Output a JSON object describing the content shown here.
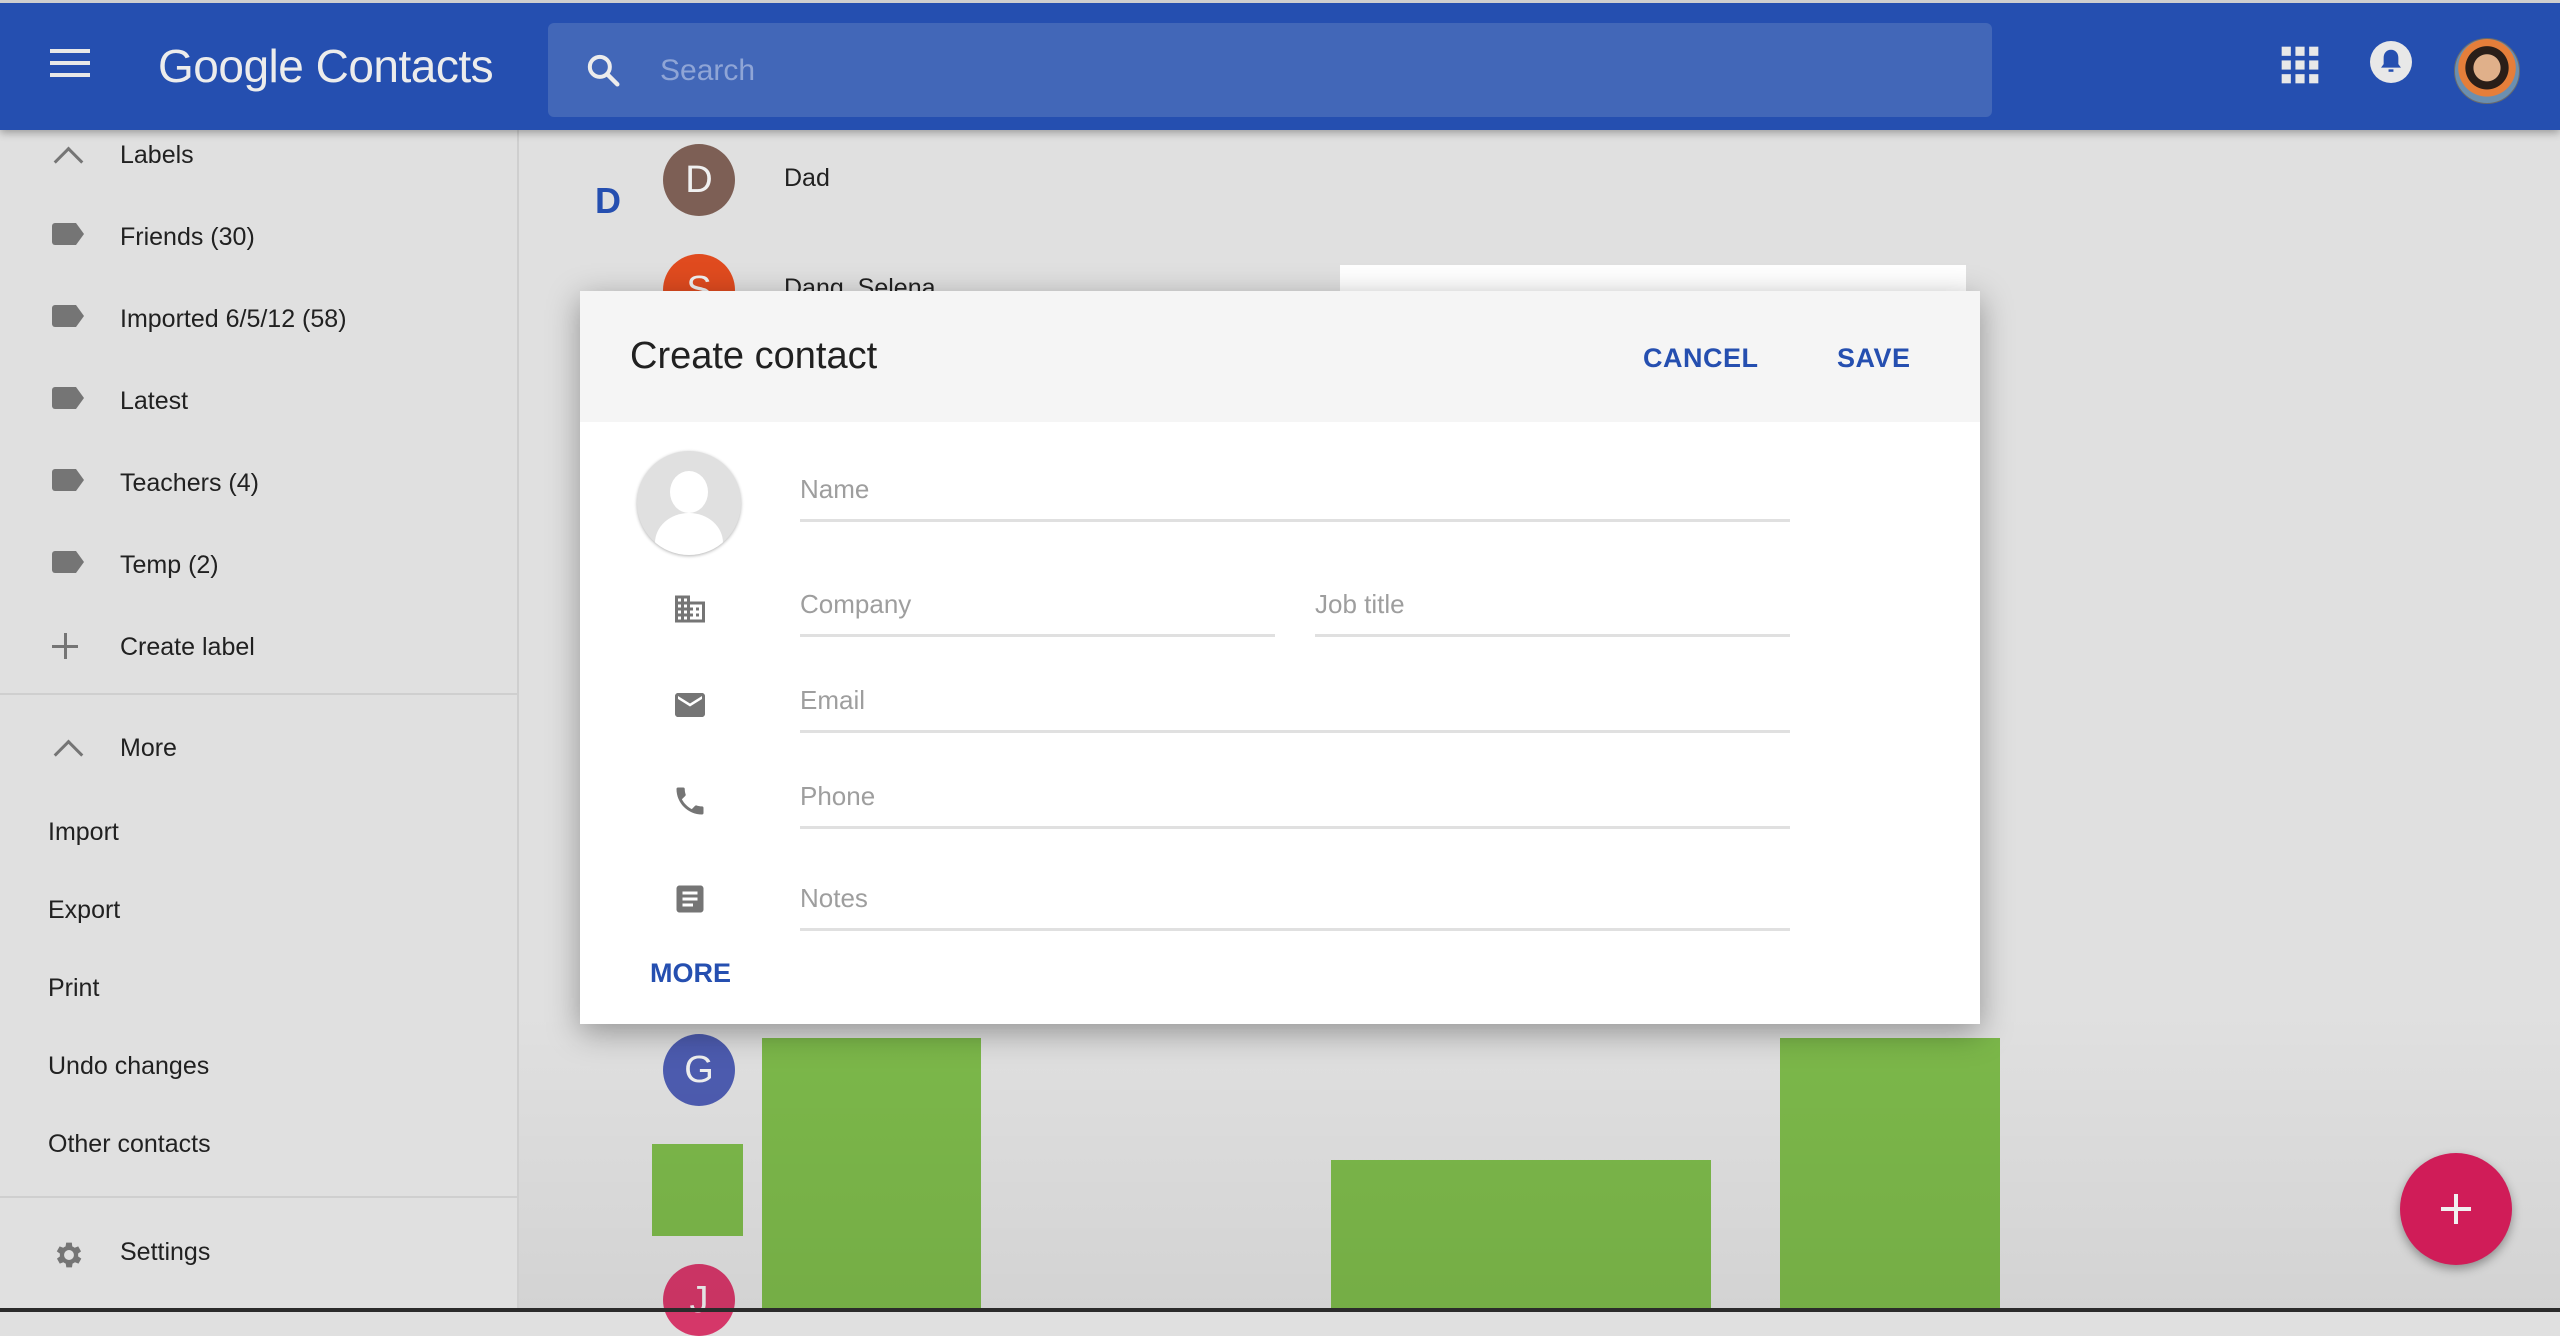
{
  "app": {
    "brand": "Google",
    "product": "Contacts"
  },
  "search": {
    "placeholder": "Search",
    "value": ""
  },
  "header_icons": {
    "apps": "apps-grid-icon",
    "notifications": "notifications-bell-icon",
    "account": "account-avatar"
  },
  "sidebar": {
    "labels_header": "Labels",
    "labels": [
      {
        "label": "Friends (30)",
        "icon": "label-icon"
      },
      {
        "label": "Imported 6/5/12 (58)",
        "icon": "label-icon"
      },
      {
        "label": "Latest",
        "icon": "label-icon"
      },
      {
        "label": "Teachers (4)",
        "icon": "label-icon"
      },
      {
        "label": "Temp (2)",
        "icon": "label-icon"
      }
    ],
    "create_label": "Create label",
    "more_header": "More",
    "more_items": [
      "Import",
      "Export",
      "Print",
      "Undo changes",
      "Other contacts"
    ],
    "settings": "Settings"
  },
  "contacts": {
    "section_letter": "D",
    "items": [
      {
        "initial": "D",
        "name": "Dad",
        "color": "#7d5f55"
      },
      {
        "initial": "S",
        "name": "Dang, Selena",
        "color": "#e04b1f"
      },
      {
        "initial": "G",
        "name": "",
        "color": "#4d5cb0"
      },
      {
        "initial": "J",
        "name": "",
        "color": "#d53769"
      }
    ]
  },
  "dialog": {
    "title": "Create contact",
    "cancel": "CANCEL",
    "save": "SAVE",
    "fields": {
      "name": {
        "placeholder": "Name",
        "value": ""
      },
      "company": {
        "placeholder": "Company",
        "value": ""
      },
      "job_title": {
        "placeholder": "Job title",
        "value": ""
      },
      "email": {
        "placeholder": "Email",
        "value": ""
      },
      "phone": {
        "placeholder": "Phone",
        "value": ""
      },
      "notes": {
        "placeholder": "Notes",
        "value": ""
      }
    },
    "more": "MORE"
  },
  "colors": {
    "appbar": "#254fb0",
    "accent": "#254fb0",
    "fab": "#d01c58",
    "placeholder_block": "#7cb84a"
  }
}
